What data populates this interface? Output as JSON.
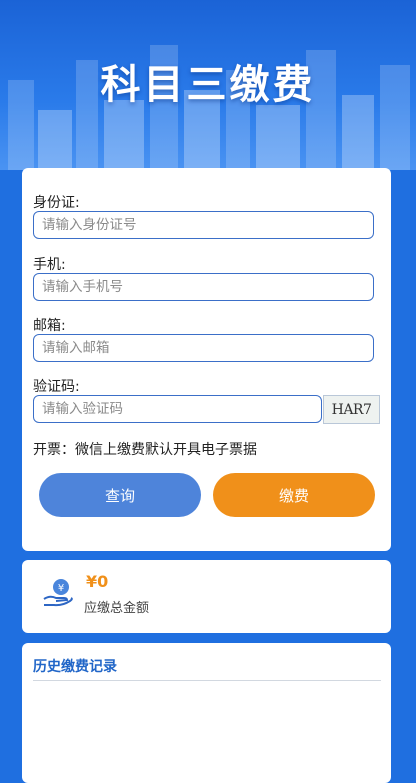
{
  "header": {
    "title": "科目三缴费"
  },
  "form": {
    "id_label": "身份证:",
    "id_placeholder": "请输入身份证号",
    "phone_label": "手机:",
    "phone_placeholder": "请输入手机号",
    "email_label": "邮箱:",
    "email_placeholder": "请输入邮箱",
    "code_label": "验证码:",
    "code_placeholder": "请输入验证码",
    "captcha_text": "HAR7",
    "invoice_note": "开票：微信上缴费默认开具电子票据",
    "query_button": "查询",
    "pay_button": "缴费"
  },
  "amount": {
    "icon": "yen-coin-hand-icon",
    "value": "¥0",
    "label": "应缴总金额"
  },
  "history": {
    "title": "历史缴费记录"
  },
  "colors": {
    "brand_blue": "#1f6fe0",
    "query_button": "#4e84da",
    "pay_button": "#f0901a",
    "amount_text": "#f0901a",
    "history_title": "#2166c8"
  }
}
